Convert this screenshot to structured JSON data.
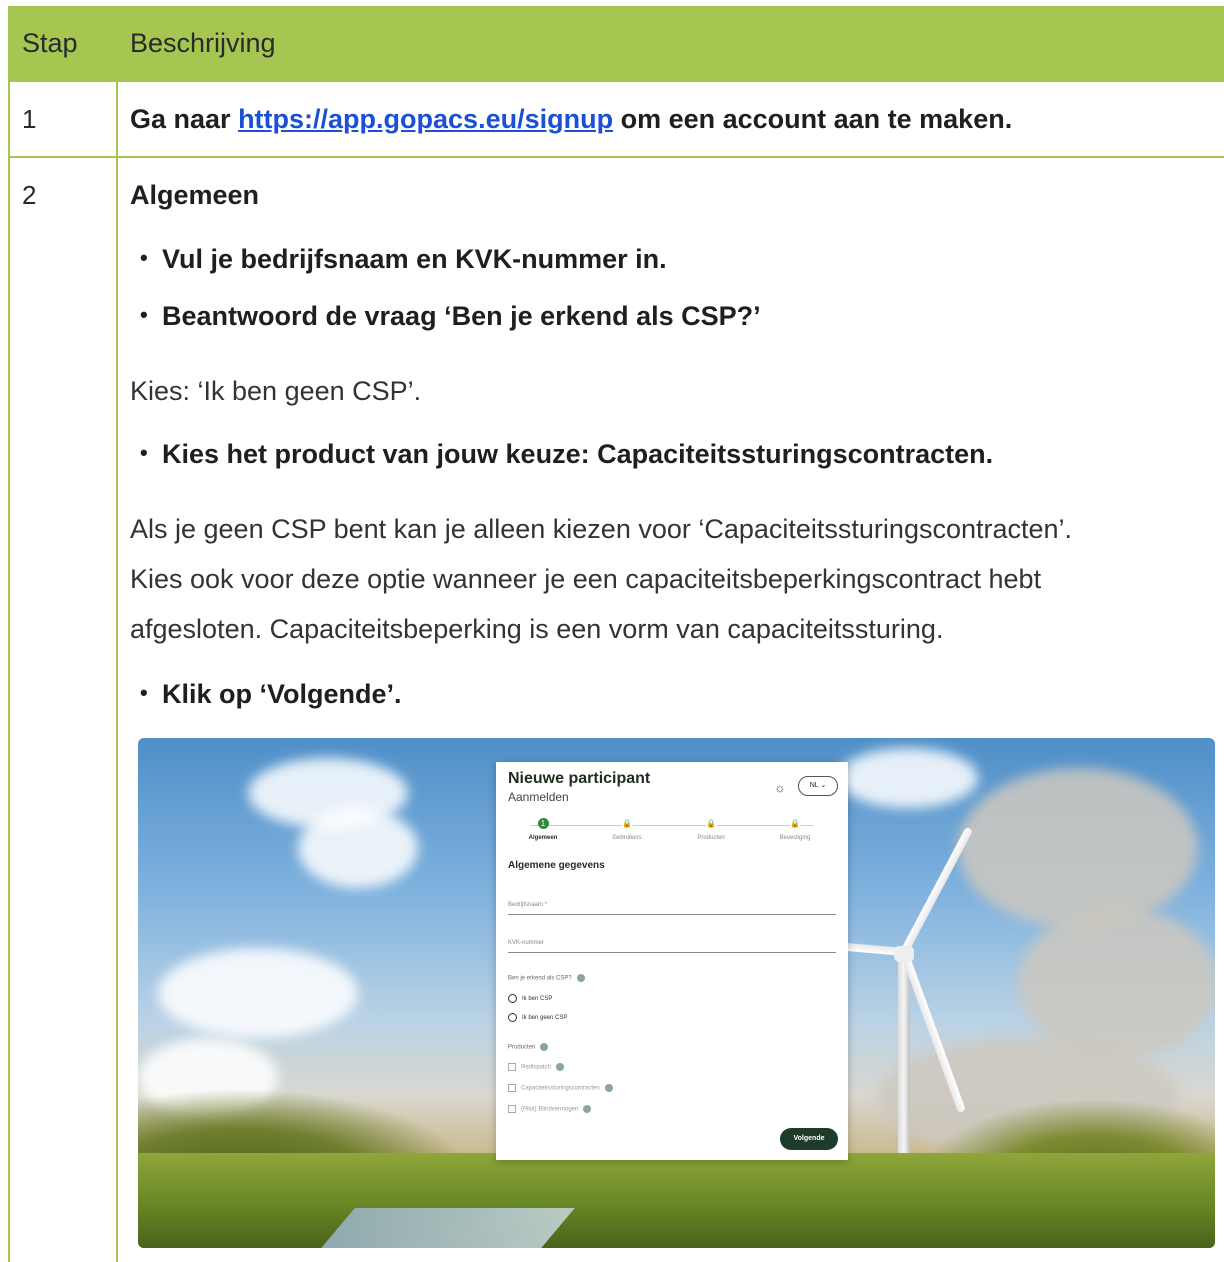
{
  "table": {
    "header": {
      "col_step": "Stap",
      "col_desc": "Beschrijving"
    },
    "row1": {
      "num": "1",
      "prefix": "Ga naar ",
      "link": "https://app.gopacs.eu/signup",
      "suffix": " om een account aan te maken."
    },
    "row2": {
      "num": "2",
      "heading": "Algemeen",
      "bullet1": "Vul je bedrijfsnaam en KVK-nummer in.",
      "bullet2": "Beantwoord de vraag ‘Ben je erkend als CSP?’",
      "para1": "Kies: ‘Ik ben geen CSP’.",
      "bullet3": "Kies het product van jouw keuze: Capaciteitssturingscontracten.",
      "para2_line1": "Als je geen CSP bent kan je alleen kiezen voor ‘Capaciteitssturingscontracten’.",
      "para2_line2": "Kies ook voor deze optie wanneer je een capaciteitsbeperkingscontract hebt",
      "para2_line3": "afgesloten. Capaciteitsbeperking is een vorm van capaciteitssturing.",
      "bullet4": "Klik op ‘Volgende’."
    }
  },
  "form": {
    "title": "Nieuwe participant",
    "subtitle": "Aanmelden",
    "lang": "NL ⌄",
    "steps": [
      {
        "num": "1",
        "label": "Algemeen"
      },
      {
        "num": "🔒",
        "label": "Gebruikers"
      },
      {
        "num": "🔒",
        "label": "Producten"
      },
      {
        "num": "🔒",
        "label": "Bevestiging"
      }
    ],
    "section_title": "Algemene gegevens",
    "field_company": "Bedrijfsnaam *",
    "field_kvk": "KVK-nummer",
    "question_csp": "Ben je erkend als CSP?",
    "radio_csp": "Ik ben CSP",
    "radio_no_csp": "Ik ben geen CSP",
    "products_label": "Producten",
    "product1": "Redispatch",
    "product2": "Capaciteitssturingscontracten",
    "product3": "(Pilot) Blindvermogen",
    "next_button": "Volgende"
  }
}
